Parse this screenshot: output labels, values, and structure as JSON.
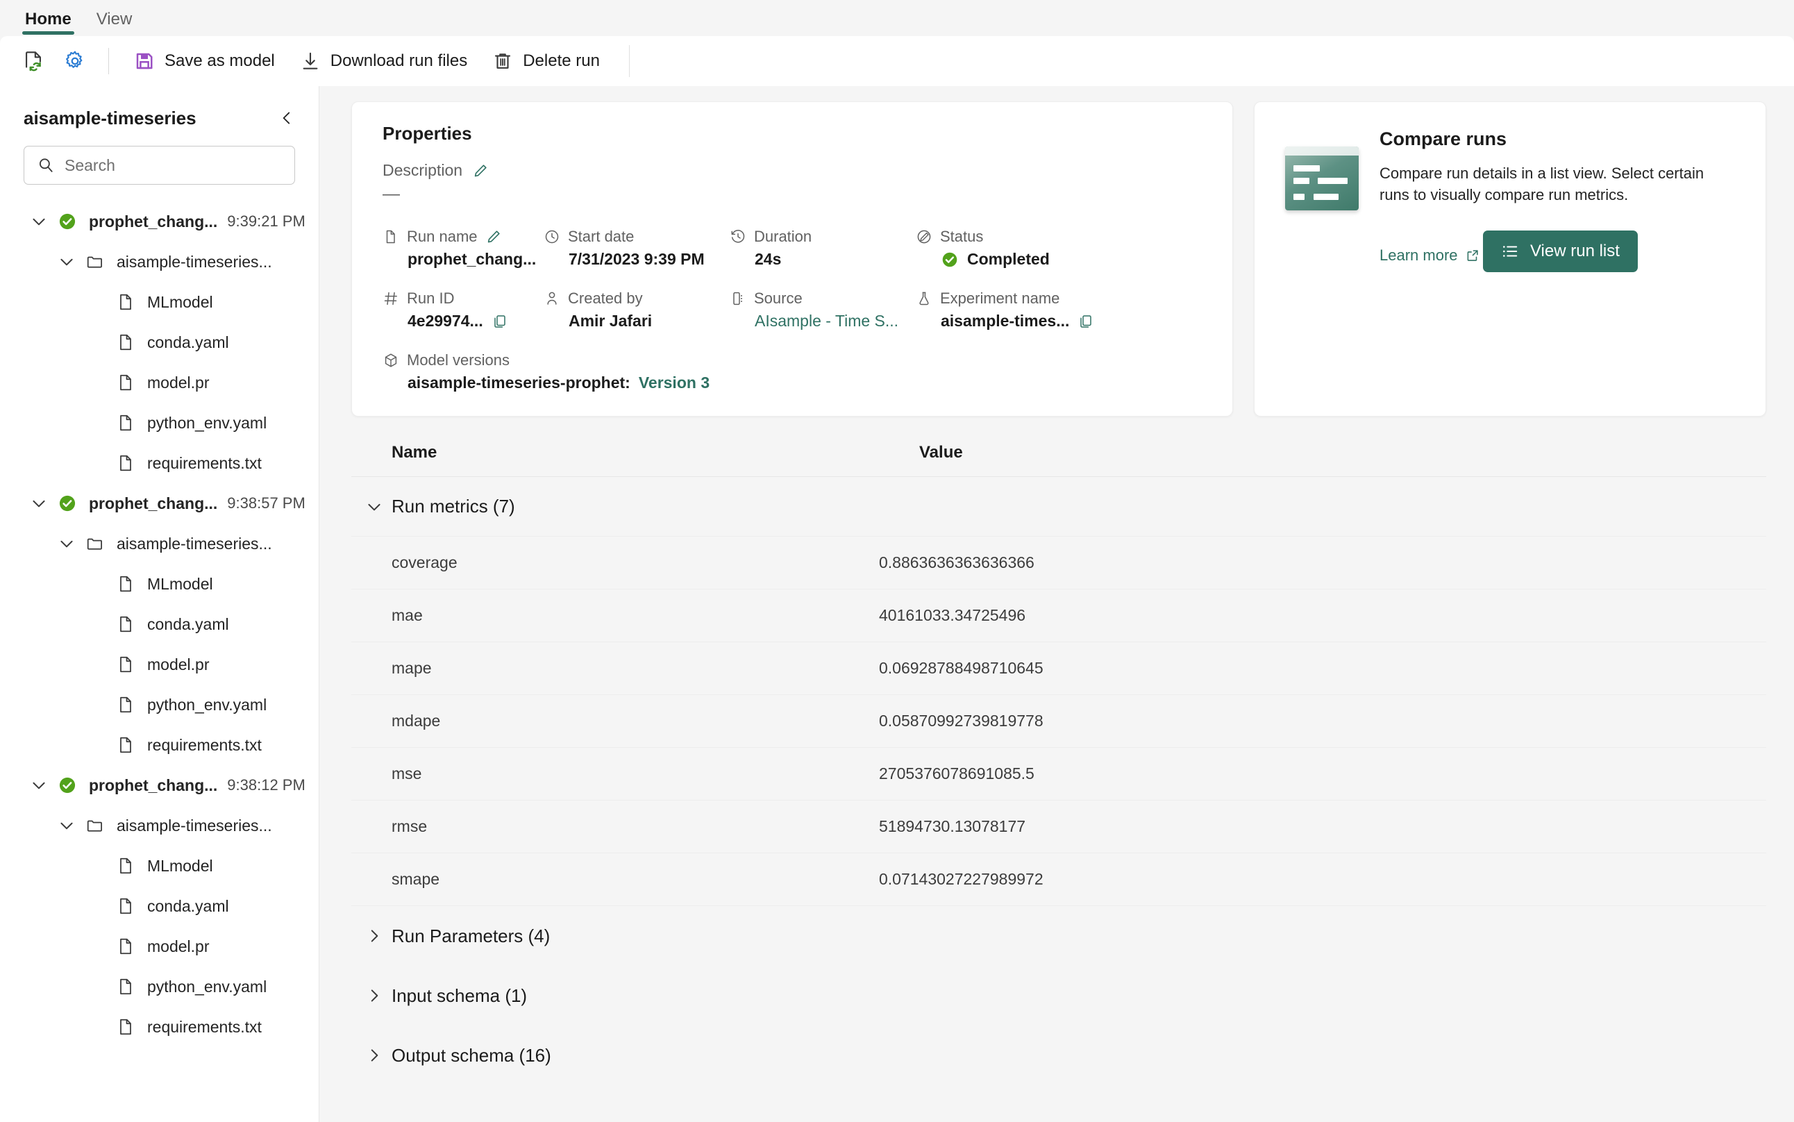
{
  "ribbon": {
    "tabs": [
      {
        "label": "Home",
        "active": true
      },
      {
        "label": "View",
        "active": false
      }
    ]
  },
  "toolbar": {
    "refresh_icon": "refresh-document-icon",
    "settings_icon": "gear-icon",
    "buttons": [
      {
        "label": "Save as model",
        "icon": "save-floppy-icon"
      },
      {
        "label": "Download run files",
        "icon": "download-arrow-icon"
      },
      {
        "label": "Delete run",
        "icon": "trash-icon"
      }
    ]
  },
  "sidebar": {
    "title": "aisample-timeseries",
    "collapse_icon": "chevron-left-icon",
    "search": {
      "placeholder": "Search",
      "value": "",
      "icon": "search-icon"
    },
    "tree": [
      {
        "level": 0,
        "type": "run",
        "icon": "check-circle-icon",
        "label": "prophet_chang...",
        "time": "9:39:21 PM",
        "expanded": true
      },
      {
        "level": 1,
        "type": "folder",
        "icon": "folder-icon",
        "label": "aisample-timeseries...",
        "expanded": true
      },
      {
        "level": 2,
        "type": "file",
        "icon": "file-icon",
        "label": "MLmodel"
      },
      {
        "level": 2,
        "type": "file",
        "icon": "file-icon",
        "label": "conda.yaml"
      },
      {
        "level": 2,
        "type": "file",
        "icon": "file-icon",
        "label": "model.pr"
      },
      {
        "level": 2,
        "type": "file",
        "icon": "file-icon",
        "label": "python_env.yaml"
      },
      {
        "level": 2,
        "type": "file",
        "icon": "file-icon",
        "label": "requirements.txt"
      },
      {
        "level": 0,
        "type": "run",
        "icon": "check-circle-icon",
        "label": "prophet_chang...",
        "time": "9:38:57 PM",
        "expanded": true
      },
      {
        "level": 1,
        "type": "folder",
        "icon": "folder-icon",
        "label": "aisample-timeseries...",
        "expanded": true
      },
      {
        "level": 2,
        "type": "file",
        "icon": "file-icon",
        "label": "MLmodel"
      },
      {
        "level": 2,
        "type": "file",
        "icon": "file-icon",
        "label": "conda.yaml"
      },
      {
        "level": 2,
        "type": "file",
        "icon": "file-icon",
        "label": "model.pr"
      },
      {
        "level": 2,
        "type": "file",
        "icon": "file-icon",
        "label": "python_env.yaml"
      },
      {
        "level": 2,
        "type": "file",
        "icon": "file-icon",
        "label": "requirements.txt"
      },
      {
        "level": 0,
        "type": "run",
        "icon": "check-circle-icon",
        "label": "prophet_chang...",
        "time": "9:38:12 PM",
        "expanded": true
      },
      {
        "level": 1,
        "type": "folder",
        "icon": "folder-icon",
        "label": "aisample-timeseries...",
        "expanded": true
      },
      {
        "level": 2,
        "type": "file",
        "icon": "file-icon",
        "label": "MLmodel"
      },
      {
        "level": 2,
        "type": "file",
        "icon": "file-icon",
        "label": "conda.yaml"
      },
      {
        "level": 2,
        "type": "file",
        "icon": "file-icon",
        "label": "model.pr"
      },
      {
        "level": 2,
        "type": "file",
        "icon": "file-icon",
        "label": "python_env.yaml"
      },
      {
        "level": 2,
        "type": "file",
        "icon": "file-icon",
        "label": "requirements.txt"
      }
    ]
  },
  "properties": {
    "title": "Properties",
    "description_label": "Description",
    "description_value": "—",
    "edit_icon": "pencil-icon",
    "fields": [
      {
        "label": "Run name",
        "value": "prophet_chang...",
        "icon": "document-icon",
        "editable": true,
        "bold": true
      },
      {
        "label": "Start date",
        "value": "7/31/2023 9:39 PM",
        "icon": "clock-icon",
        "bold": true
      },
      {
        "label": "Duration",
        "value": "24s",
        "icon": "duration-icon",
        "bold": true
      },
      {
        "label": "Status",
        "value": "Completed",
        "icon": "status-icon",
        "bold": true,
        "status": "completed"
      },
      {
        "label": "Run ID",
        "value": "4e29974...",
        "icon": "hash-icon",
        "bold": true,
        "copyable": true
      },
      {
        "label": "Created by",
        "value": "Amir Jafari",
        "icon": "person-icon",
        "bold": true
      },
      {
        "label": "Source",
        "value": "AIsample - Time S...",
        "icon": "server-icon",
        "link": true
      },
      {
        "label": "Experiment name",
        "value": "aisample-times...",
        "icon": "flask-icon",
        "bold": true,
        "copyable": true
      },
      {
        "label": "Model versions",
        "value": "aisample-timeseries-prophet:",
        "link_suffix": " Version 3",
        "icon": "cube-icon",
        "bold": true
      }
    ]
  },
  "compare": {
    "title": "Compare runs",
    "description": "Compare run details in a list view. Select certain runs to visually compare run metrics.",
    "learn_more": "Learn more",
    "learn_more_icon": "external-link-icon",
    "button_label": "View run list",
    "button_icon": "list-icon",
    "thumbnail_icon": "compare-runs-thumbnail",
    "accent_color": "#2f7163"
  },
  "table": {
    "columns": {
      "name": "Name",
      "value": "Value"
    },
    "sections": [
      {
        "label": "Run metrics (7)",
        "expanded": true,
        "chevron": "chevron-down-icon",
        "rows": [
          {
            "name": "coverage",
            "value": "0.8863636363636366"
          },
          {
            "name": "mae",
            "value": "40161033.34725496"
          },
          {
            "name": "mape",
            "value": "0.06928788498710645"
          },
          {
            "name": "mdape",
            "value": "0.05870992739819778"
          },
          {
            "name": "mse",
            "value": "2705376078691085.5"
          },
          {
            "name": "rmse",
            "value": "51894730.13078177"
          },
          {
            "name": "smape",
            "value": "0.07143027227989972"
          }
        ]
      },
      {
        "label": "Run Parameters (4)",
        "expanded": false,
        "chevron": "chevron-right-icon",
        "rows": []
      },
      {
        "label": "Input schema (1)",
        "expanded": false,
        "chevron": "chevron-right-icon",
        "rows": []
      },
      {
        "label": "Output schema (16)",
        "expanded": false,
        "chevron": "chevron-right-icon",
        "rows": []
      }
    ]
  },
  "colors": {
    "accent": "#2f7163",
    "success": "#4caf1f",
    "save_icon": "#9b51c4",
    "gear_icon": "#2b7cd3",
    "refresh_icon": "#3f8f29"
  }
}
